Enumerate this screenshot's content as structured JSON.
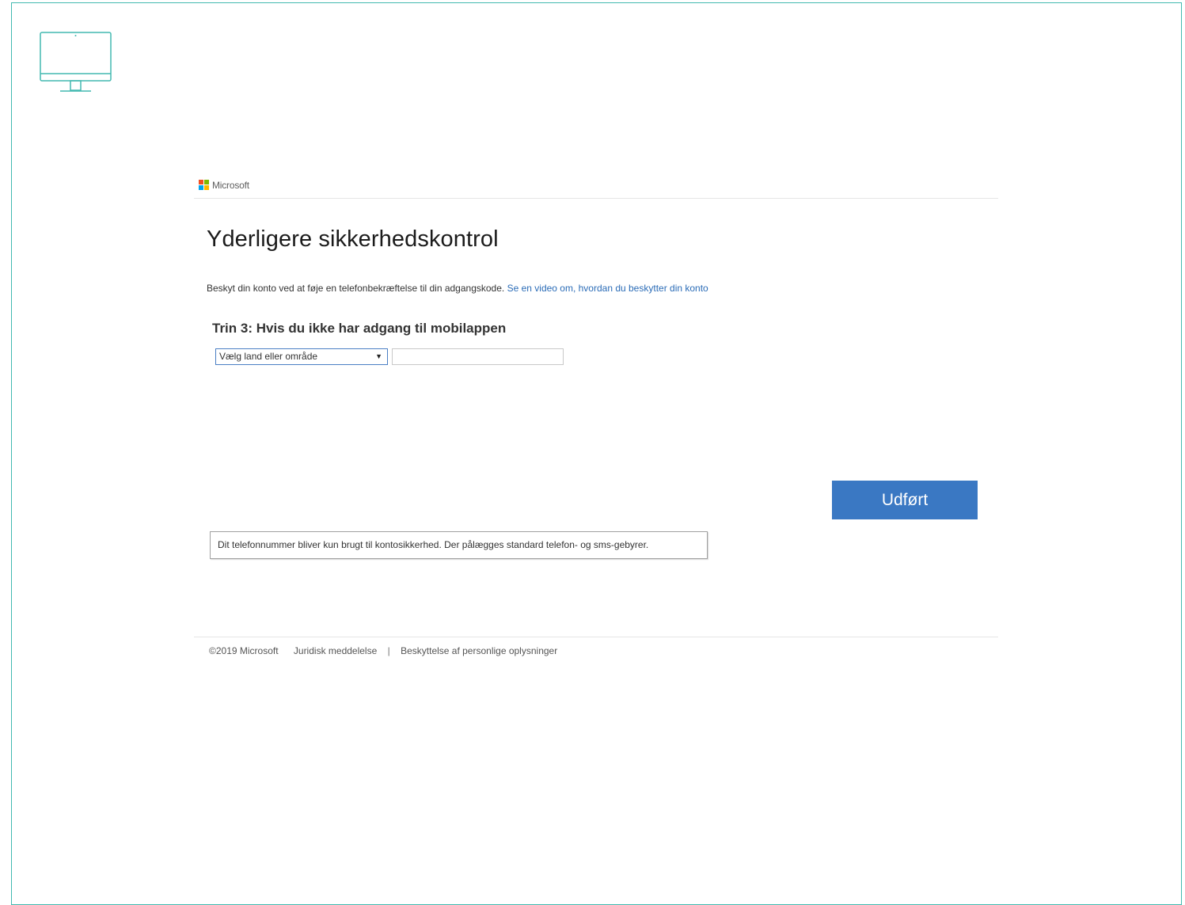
{
  "header": {
    "brand": "Microsoft"
  },
  "main": {
    "title": "Yderligere sikkerhedskontrol",
    "intro_text": "Beskyt din konto ved at føje en telefonbekræftelse til din adgangskode.",
    "intro_link": "Se en video om, hvordan du beskytter din konto",
    "step_heading": "Trin 3: Hvis du ikke har adgang til mobilappen",
    "country_select_value": "Vælg land eller område",
    "phone_value": "",
    "done_button": "Udført",
    "notice": "Dit telefonnummer bliver kun brugt til kontosikkerhed. Der pålægges standard telefon- og sms-gebyrer."
  },
  "footer": {
    "copyright": "©2019 Microsoft",
    "legal_link": "Juridisk meddelelse",
    "separator": "|",
    "privacy_link": "Beskyttelse af personlige oplysninger"
  },
  "colors": {
    "frame": "#42b9b0",
    "primary_button": "#3a78c3",
    "link": "#2b6cb7"
  },
  "icons": {
    "device": "monitor-icon",
    "logo": "microsoft-logo-icon"
  }
}
